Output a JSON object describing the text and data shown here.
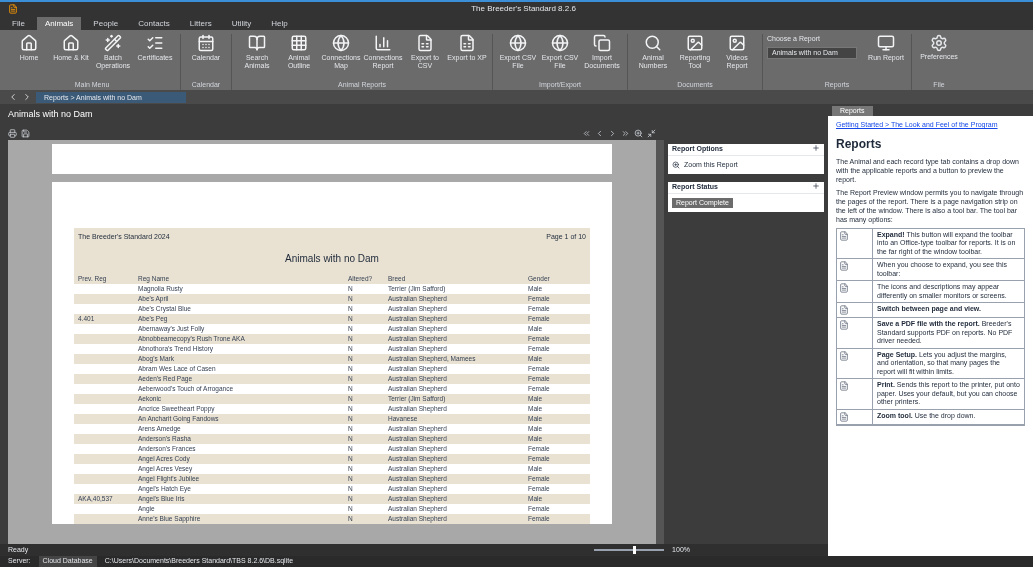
{
  "window": {
    "title": "The Breeder's Standard 8.2.6"
  },
  "tabs": [
    {
      "label": "File",
      "selected": false
    },
    {
      "label": "Animals",
      "selected": true
    },
    {
      "label": "People",
      "selected": false
    },
    {
      "label": "Contacts",
      "selected": false
    },
    {
      "label": "Litters",
      "selected": false
    },
    {
      "label": "Utility",
      "selected": false
    },
    {
      "label": "Help",
      "selected": false
    }
  ],
  "ribbon_groups": [
    {
      "label": "Main Menu",
      "buttons": [
        "Home",
        "Home & Kit",
        "Batch Operations",
        "Certificates"
      ]
    },
    {
      "label": "Calendar",
      "buttons": [
        "Calendar"
      ]
    },
    {
      "label": "Animal Reports",
      "buttons": [
        "Search Animals",
        "Animal Outline",
        "Connections Map",
        "Connections Report",
        "Export to CSV",
        "Export to XP"
      ]
    },
    {
      "label": "Import/Export",
      "buttons": [
        "Export CSV File",
        "Export CSV File",
        "Import Documents"
      ]
    },
    {
      "label": "Documents",
      "buttons": [
        "Animal Numbers",
        "Reporting Tool",
        "Videos Report"
      ]
    }
  ],
  "report_group": {
    "label": "Reports",
    "caption": "Choose a Report",
    "value": "Animals with no Dam",
    "run": "Run Report"
  },
  "file_group": {
    "label": "File",
    "button": "Preferences"
  },
  "path_text": "Reports > Animals with no Dam",
  "document": {
    "title": "Animals with no Dam",
    "report": {
      "header_left": "The Breeder's Standard 2024",
      "header_right": "Page 1 of 10",
      "title": "Animals with no Dam",
      "columns": [
        "Prev. Reg",
        "Reg Name",
        "Altered?",
        "Breed",
        "Gender"
      ],
      "rows": [
        [
          "",
          "Magnolia Rusty",
          "N",
          "Terrier (Jim Safford)",
          "Male"
        ],
        [
          "",
          "Abe's April",
          "N",
          "Australian Shepherd",
          "Female"
        ],
        [
          "",
          "Abe's Crystal Blue",
          "N",
          "Australian Shepherd",
          "Female"
        ],
        [
          "4.401",
          "Abe's Peg",
          "N",
          "Australian Shepherd",
          "Female"
        ],
        [
          "",
          "Abernaway's Just Folly",
          "N",
          "Australian Shepherd",
          "Male"
        ],
        [
          "",
          "Abnobbeamecopy's Rush Trone AKA",
          "N",
          "Australian Shepherd",
          "Female"
        ],
        [
          "",
          "Abnothora's Trend History",
          "N",
          "Australian Shepherd",
          "Female"
        ],
        [
          "",
          "Abog's Mark",
          "N",
          "Australian Shepherd, Mamees",
          "Male"
        ],
        [
          "",
          "Abram Wes Lace of Casen",
          "N",
          "Australian Shepherd",
          "Female"
        ],
        [
          "",
          "Aeden's Red Page",
          "N",
          "Australian Shepherd",
          "Female"
        ],
        [
          "",
          "Aeberwood's Touch of Arrogance",
          "N",
          "Australian Shepherd",
          "Female"
        ],
        [
          "",
          "Aekonic",
          "N",
          "Terrier (Jim Safford)",
          "Male"
        ],
        [
          "",
          "Ancrice Sweetheart Poppy",
          "N",
          "Australian Shepherd",
          "Male"
        ],
        [
          "",
          "An Ancharit Going Fandows",
          "N",
          "Havanese",
          "Male"
        ],
        [
          "",
          "Arens Amedge",
          "N",
          "Australian Shepherd",
          "Male"
        ],
        [
          "",
          "Anderson's Rasha",
          "N",
          "Australian Shepherd",
          "Male"
        ],
        [
          "",
          "Anderson's Frances",
          "N",
          "Australian Shepherd",
          "Female"
        ],
        [
          "",
          "Angel Acres Cody",
          "N",
          "Australian Shepherd",
          "Female"
        ],
        [
          "",
          "Angel Acres Vesey",
          "N",
          "Australian Shepherd",
          "Male"
        ],
        [
          "",
          "Angel Flight's Jubilee",
          "N",
          "Australian Shepherd",
          "Female"
        ],
        [
          "",
          "Angel's Hatch Eye",
          "N",
          "Australian Shepherd",
          "Female"
        ],
        [
          "AKA,40,537",
          "Angel's Blue Iris",
          "N",
          "Australian Shepherd",
          "Male"
        ],
        [
          "",
          "Angie",
          "N",
          "Australian Shepherd",
          "Female"
        ],
        [
          "",
          "Anne's Blue Sapphire",
          "N",
          "Australian Shepherd",
          "Female"
        ]
      ]
    },
    "options": [
      {
        "title": "Report Options",
        "item": "Zoom this Report"
      },
      {
        "title": "Report Status",
        "item": "Report Complete"
      }
    ]
  },
  "help": {
    "tabs": [
      {
        "label": "Reports",
        "selected": true
      }
    ],
    "breadcrumb": "Getting Started > The Look and Feel of the Program",
    "heading": "Reports",
    "paragraphs": [
      "The Animal and each record type tab contains a drop down with the applicable reports and a button to preview the report.",
      "The Report Preview window permits you to navigate through the pages of the report. There is a page navigation strip on the left of the window. There is also a tool bar. The tool bar has many options:"
    ],
    "rows": [
      {
        "bold": "Expand!",
        "text": "This button will expand the toolbar into an Office-type toolbar for reports. It is on the far right of the window toolbar."
      },
      {
        "bold": "",
        "text": "When you choose to expand, you see this toolbar:"
      },
      {
        "bold": "",
        "text": "The icons and descriptions may appear differently on smaller monitors or screens."
      },
      {
        "bold": "Switch between page and view.",
        "text": ""
      },
      {
        "bold": "Save a PDF file with the report.",
        "text": "Breeder's Standard supports PDF on reports. No PDF driver needed."
      },
      {
        "bold": "Page Setup.",
        "text": "Lets you adjust the margins, and orientation, so that many pages the report will fit within limits."
      },
      {
        "bold": "Print.",
        "text": "Sends this report to the printer, put onto paper. Uses your default, but you can choose other printers."
      },
      {
        "bold": "Zoom tool.",
        "text": "Use the drop down."
      }
    ]
  },
  "status": {
    "ready": "Ready",
    "zoom": "100%",
    "level": 0.55,
    "bottom_label": "Server:",
    "bottom_value": "Cloud Database",
    "path": "C:\\Users\\Documents\\Breeders Standard\\TBS 8.2.6\\DB.sqlite"
  }
}
